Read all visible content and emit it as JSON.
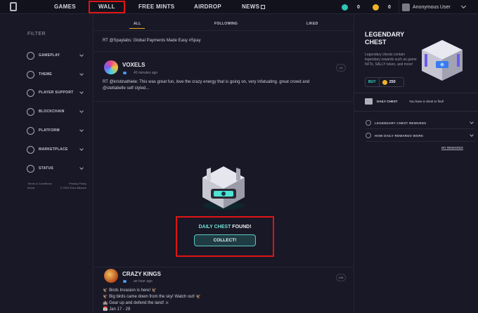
{
  "nav": {
    "items": [
      "GAMES",
      "WALL",
      "FREE MINTS",
      "AIRDROP",
      "NEWS"
    ],
    "active": "WALL"
  },
  "balances": [
    {
      "icon": "gem-icon",
      "value": "0",
      "color": "#2ec4b6"
    },
    {
      "icon": "coin-icon",
      "value": "0",
      "color": "#f0b428"
    }
  ],
  "user": {
    "name": "Anonymous User"
  },
  "sidebar": {
    "title": "FILTER",
    "items": [
      {
        "label": "GAMEPLAY",
        "icon": "gamepad-icon"
      },
      {
        "label": "THEME",
        "icon": "theme-icon"
      },
      {
        "label": "PLAYER SUPPORT",
        "icon": "support-icon"
      },
      {
        "label": "BLOCKCHAIN",
        "icon": "blockchain-icon"
      },
      {
        "label": "PLATFORM",
        "icon": "platform-icon"
      },
      {
        "label": "MARKETPLACE",
        "icon": "marketplace-icon"
      },
      {
        "label": "STATUS",
        "icon": "status-icon"
      }
    ],
    "footer": {
      "terms": "Terms & Conditions",
      "privacy": "Privacy Policy",
      "about": "About",
      "copyright": "© 2023 Earn Alliance"
    }
  },
  "feed": {
    "tabs": [
      "ALL",
      "FOLLOWING",
      "LIKED"
    ],
    "active_tab": "ALL",
    "posts": [
      {
        "text": "RT @Spaylabs: Global Payments Made Easy #Spay"
      },
      {
        "name": "VOXELS",
        "time": "40 minutes ago",
        "likes": "14",
        "text_line1": "RT @kristinathiele: This was great fun, love the crazy energy that is going on, very infatuating. great crowd and",
        "text_line2": "@stellabelle self styled..."
      },
      {
        "name": "CRAZY KINGS",
        "time": "an hour ago",
        "likes": "105",
        "lines": [
          "🦅 Birds Invasion is here! 🦅",
          "🦅 Big birds came down from the sky! Watch out! 🦅",
          "🏰 Gear up and defend the land! ⚔",
          "📅 Jan 17 - 29"
        ]
      }
    ],
    "chest": {
      "found_prefix": "DAILY CHEST",
      "found_suffix": " FOUND!",
      "collect_label": "COLLECT!"
    }
  },
  "right": {
    "title": "LEGENDARY CHEST",
    "description": "Legendary chests contain legendary rewards such as game NFTs, SALLY token, and more!",
    "buy_label": "BUY",
    "buy_amount": "250",
    "daily_chest_label": "DAILY CHEST",
    "daily_chest_message": "You have a chest to find!",
    "accordion": [
      {
        "label": "LEGENDARY CHEST REWARDS",
        "icon": "chest-rewards-icon"
      },
      {
        "label": "HOW DAILY REWARDS WORK",
        "icon": "help-icon"
      }
    ],
    "my_rewards": "MY REWARDS"
  }
}
